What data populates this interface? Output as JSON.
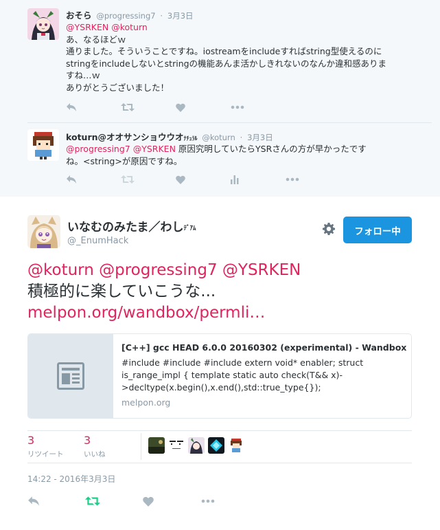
{
  "replies": [
    {
      "name": "おそら",
      "handle": "@progressing7",
      "date": "3月3日",
      "mentions": [
        "@YSRKEN",
        "@koturn"
      ],
      "lines": [
        "あ、なるほどｗ",
        "通りました。そういうことですね。iostreamをincludeすればstring型使えるのに",
        "stringをincludeしないとstringの機能あんま活かしきれないのなんか違和感ありま",
        "すね…ｗ",
        "ありがとうございました！"
      ]
    },
    {
      "name": "koturn@オオサンショウウオ",
      "name_suffix": "ﾅﾁｭﾗﾙ",
      "handle": "@koturn",
      "date": "3月3日",
      "mentions": [
        "@progressing7",
        "@YSRKEN"
      ],
      "text_after_mentions": "原因究明していたらYSRさんの方が早かったです",
      "line2": "ね。<string>が原因ですね。"
    }
  ],
  "main_tweet": {
    "name": "いなむのみたま／わし",
    "name_suffix": "ﾃﾞｱﾑ",
    "handle": "@_EnumHack",
    "follow_label": "フォロー中",
    "mentions": "@koturn @progressing7 @YSRKEN",
    "text": "積極的に楽していこうな...",
    "link": "melpon.org/wandbox/permli…",
    "card": {
      "title": "[C++] gcc HEAD 6.0.0 20160302 (experimental) - Wandbox",
      "description": "#include #include #include extern void* enabler; struct is_range_impl { template static auto check(T&& x)->decltype(x.begin(),x.end(),std::true_type{});",
      "domain": "melpon.org"
    },
    "retweets": {
      "count": "3",
      "label": "リツイート"
    },
    "likes": {
      "count": "3",
      "label": "いいね"
    },
    "timestamp": "14:22 - 2016年3月3日"
  },
  "colors": {
    "accent_pink": "#e0245e",
    "follow_blue": "#1b95e0",
    "retweet_green": "#19cf86",
    "muted": "#aab8c2",
    "meta_gray": "#8899a6",
    "reply_bg": "#f5f8fa"
  },
  "icons": [
    "reply-icon",
    "retweet-icon",
    "like-icon",
    "more-icon",
    "analytics-icon",
    "gear-icon",
    "article-icon"
  ]
}
